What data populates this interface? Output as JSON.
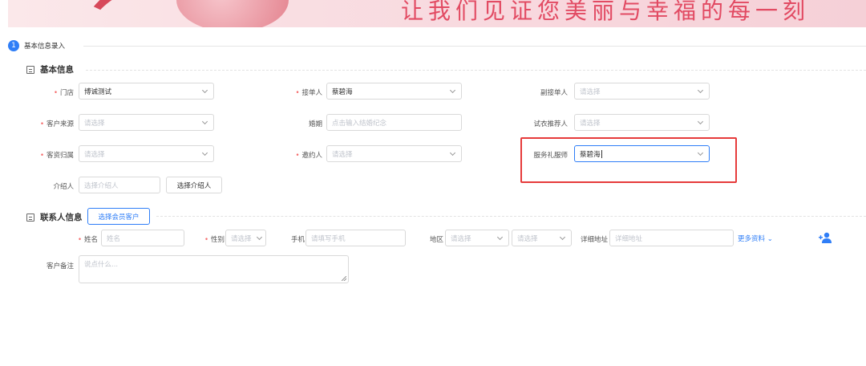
{
  "banner": {
    "slogan": "让我们见证您美丽与幸福的每一刻"
  },
  "step": {
    "number": "1",
    "title": "基本信息录入"
  },
  "sections": {
    "basic": "基本信息",
    "contact": "联系人信息"
  },
  "fields": {
    "store": {
      "label": "门店",
      "value": "博诚测试"
    },
    "receiver": {
      "label": "接单人",
      "value": "蔡碧海"
    },
    "vice_receiver": {
      "label": "副接单人",
      "placeholder": "请选择"
    },
    "source": {
      "label": "客户来源",
      "placeholder": "请选择"
    },
    "wedding": {
      "label": "婚期",
      "placeholder": "点击输入结婚纪念"
    },
    "fitting_recommender": {
      "label": "试衣推荐人",
      "placeholder": "请选择"
    },
    "belonging": {
      "label": "客资归属",
      "placeholder": "请选择"
    },
    "inviter": {
      "label": "邀约人",
      "placeholder": "请选择"
    },
    "service_dresser": {
      "label": "服务礼服师",
      "value": "蔡碧海"
    },
    "introducer": {
      "label": "介绍人",
      "placeholder": "选择介绍人",
      "button": "选择介绍人"
    }
  },
  "contact": {
    "select_member_button": "选择会员客户",
    "name": {
      "label": "姓名",
      "placeholder": "姓名"
    },
    "gender": {
      "label": "性别",
      "placeholder": "请选择"
    },
    "phone": {
      "label": "手机",
      "placeholder": "请填写手机"
    },
    "region": {
      "label": "地区",
      "placeholder1": "请选择",
      "placeholder2": "请选择"
    },
    "address": {
      "label": "详细地址",
      "placeholder": "详细地址"
    },
    "more_link": "更多资料",
    "remark": {
      "label": "客户备注",
      "placeholder": "说点什么..."
    }
  },
  "colors": {
    "primary": "#2f7ef7",
    "required": "#f56c6c",
    "highlight_box": "#e63b3b"
  }
}
